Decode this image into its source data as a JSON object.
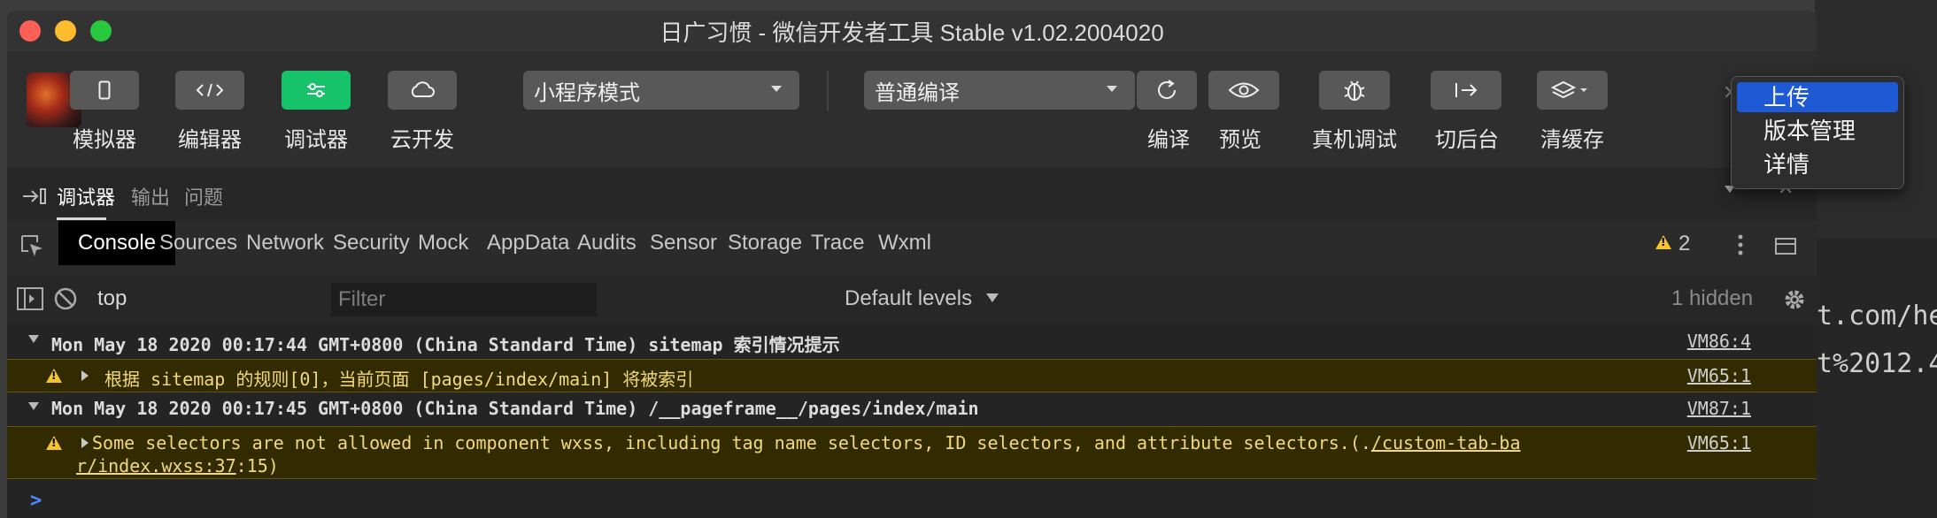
{
  "window": {
    "title": "日广习惯 - 微信开发者工具 Stable v1.02.2004020"
  },
  "background": {
    "code_line_1": "t.com/he",
    "code_line_2": "t%2012.4"
  },
  "toolbar": {
    "simulator": "模拟器",
    "editor": "编辑器",
    "debugger": "调试器",
    "cloud": "云开发",
    "mode_select": "小程序模式",
    "compile_select": "普通编译",
    "compile": "编译",
    "preview": "预览",
    "remote_debug": "真机调试",
    "background": "切后台",
    "clear_cache": "清缓存"
  },
  "context_menu": {
    "items": [
      "上传",
      "版本管理",
      "详情"
    ]
  },
  "panel_tabs": [
    "调试器",
    "输出",
    "问题"
  ],
  "devtools": {
    "tabs": [
      "Console",
      "Sources",
      "Network",
      "Security",
      "Mock",
      "AppData",
      "Audits",
      "Sensor",
      "Storage",
      "Trace",
      "Wxml"
    ],
    "warning_count": "2"
  },
  "filterbar": {
    "context": "top",
    "filter_placeholder": "Filter",
    "levels": "Default levels",
    "hidden": "1 hidden"
  },
  "console": {
    "group1": {
      "text": "Mon May 18 2020 00:17:44 GMT+0800 (China Standard Time) sitemap 索引情况提示",
      "src": "VM86:4"
    },
    "warn1": {
      "text": "根据 sitemap 的规则[0]，当前页面 [pages/index/main] 将被索引",
      "src": "VM65:1"
    },
    "group2": {
      "text": "Mon May 18 2020 00:17:45 GMT+0800 (China Standard Time) /__pageframe__/pages/index/main",
      "src": "VM87:1"
    },
    "warn2": {
      "text_a": "Some selectors are not allowed in component wxss, including tag name selectors, ID selectors, and attribute selectors.(.",
      "link_a": "/custom-tab-ba",
      "link_b": "r/index.wxss:37",
      "text_b": ":15)",
      "src": "VM65:1"
    },
    "prompt": ">"
  }
}
